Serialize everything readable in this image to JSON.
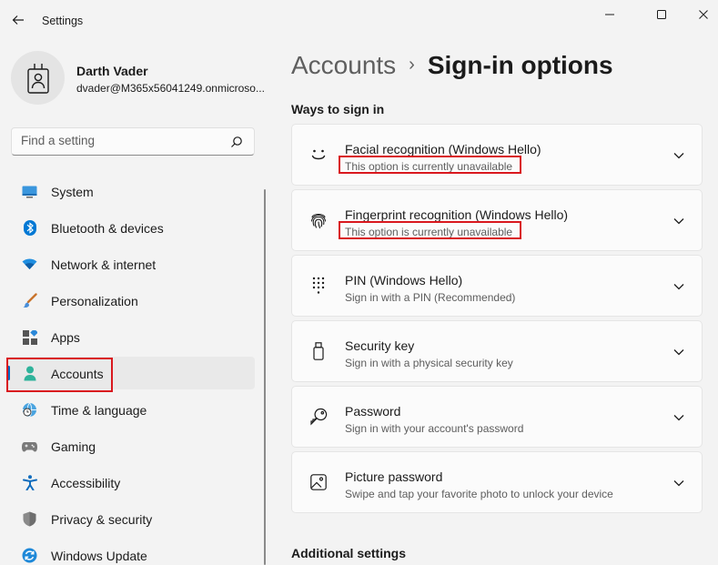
{
  "window": {
    "title": "Settings",
    "back_icon": "back-arrow-icon",
    "controls": [
      "minimize-icon",
      "maximize-icon",
      "close-icon"
    ]
  },
  "profile": {
    "name": "Darth Vader",
    "email": "dvader@M365x56041249.onmicroso...",
    "avatar_icon": "badge-person-icon"
  },
  "search": {
    "placeholder": "Find a setting",
    "value": "",
    "icon": "search-icon"
  },
  "nav": {
    "items": [
      {
        "label": "System",
        "icon": "monitor-icon",
        "active": false
      },
      {
        "label": "Bluetooth & devices",
        "icon": "bluetooth-icon",
        "active": false
      },
      {
        "label": "Network & internet",
        "icon": "wifi-icon",
        "active": false
      },
      {
        "label": "Personalization",
        "icon": "brush-icon",
        "active": false
      },
      {
        "label": "Apps",
        "icon": "apps-icon",
        "active": false
      },
      {
        "label": "Accounts",
        "icon": "person-icon",
        "active": true
      },
      {
        "label": "Time & language",
        "icon": "globe-clock-icon",
        "active": false
      },
      {
        "label": "Gaming",
        "icon": "gamepad-icon",
        "active": false
      },
      {
        "label": "Accessibility",
        "icon": "accessibility-icon",
        "active": false
      },
      {
        "label": "Privacy & security",
        "icon": "shield-icon",
        "active": false
      },
      {
        "label": "Windows Update",
        "icon": "update-icon",
        "active": false
      }
    ]
  },
  "breadcrumb": {
    "parent": "Accounts",
    "separator": "›",
    "current": "Sign-in options"
  },
  "sections": {
    "ways_title": "Ways to sign in",
    "additional_title": "Additional settings"
  },
  "options": [
    {
      "title": "Facial recognition (Windows Hello)",
      "subtitle": "This option is currently unavailable",
      "icon": "face-icon",
      "unavailable": true
    },
    {
      "title": "Fingerprint recognition (Windows Hello)",
      "subtitle": "This option is currently unavailable",
      "icon": "fingerprint-icon",
      "unavailable": true
    },
    {
      "title": "PIN (Windows Hello)",
      "subtitle": "Sign in with a PIN (Recommended)",
      "icon": "pin-keypad-icon",
      "unavailable": false
    },
    {
      "title": "Security key",
      "subtitle": "Sign in with a physical security key",
      "icon": "usb-key-icon",
      "unavailable": false
    },
    {
      "title": "Password",
      "subtitle": "Sign in with your account's password",
      "icon": "key-icon",
      "unavailable": false
    },
    {
      "title": "Picture password",
      "subtitle": "Swipe and tap your favorite photo to unlock your device",
      "icon": "picture-icon",
      "unavailable": false
    }
  ],
  "colors": {
    "accent": "#0067c0",
    "highlight": "#d9181e",
    "background": "#f3f3f3",
    "card": "#fbfbfb"
  }
}
